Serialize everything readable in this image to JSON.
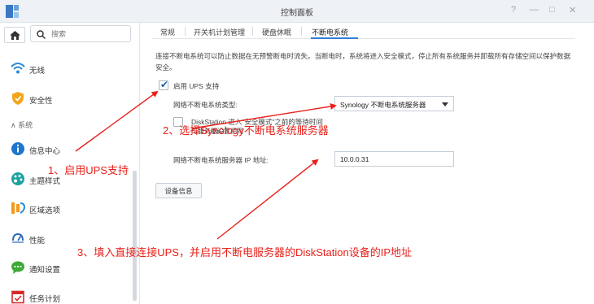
{
  "window": {
    "title": "控制面板",
    "controls": [
      "?",
      "—",
      "□",
      "✕"
    ]
  },
  "sidebar": {
    "search_placeholder": "搜索",
    "items": [
      {
        "label": "无线",
        "icon": "wifi-icon"
      },
      {
        "label": "安全性",
        "icon": "shield-icon"
      },
      {
        "label": "信息中心",
        "icon": "info-icon"
      },
      {
        "label": "主题样式",
        "icon": "palette-icon"
      },
      {
        "label": "区域选项",
        "icon": "region-icon"
      },
      {
        "label": "性能",
        "icon": "performance-icon"
      },
      {
        "label": "通知设置",
        "icon": "chat-icon"
      },
      {
        "label": "任务计划",
        "icon": "task-icon"
      }
    ],
    "section_header": "∧ 系统"
  },
  "tabs": [
    {
      "label": "常规"
    },
    {
      "label": "开关机计划管理"
    },
    {
      "label": "硬盘休眠"
    },
    {
      "label": "不断电系统"
    }
  ],
  "active_tab": "不断电系统",
  "main": {
    "description": "连接不断电系统可以防止数据在无预警断电时流失。当断电时，系统将进入安全模式，停止所有系统服务并卸载所有存储空间以保护数据安全。",
    "enable_ups_label": "启用 UPS 支持",
    "enable_ups_checked": true,
    "network_ups_type_label": "网络不断电系统类型:",
    "network_ups_type_value": "Synology 不断电系统服务器",
    "safe_mode_label_line1": "DiskStation 进入\"安全模式\"之前的等待时间",
    "safe_mode_label_line2": "与服务器设置相同",
    "safe_mode_checked": false,
    "server_ip_label": "网络不断电系统服务器 IP 地址:",
    "server_ip_value": "10.0.0.31",
    "device_info_button": "设备信息"
  },
  "annotations": {
    "step1": "1、启用UPS支持",
    "step2": "2、选择Synology不断电系统服务器",
    "step3": "3、填入直接连接UPS，并启用不断电服务器的DiskStation设备的IP地址",
    "color": "#e8201a"
  }
}
